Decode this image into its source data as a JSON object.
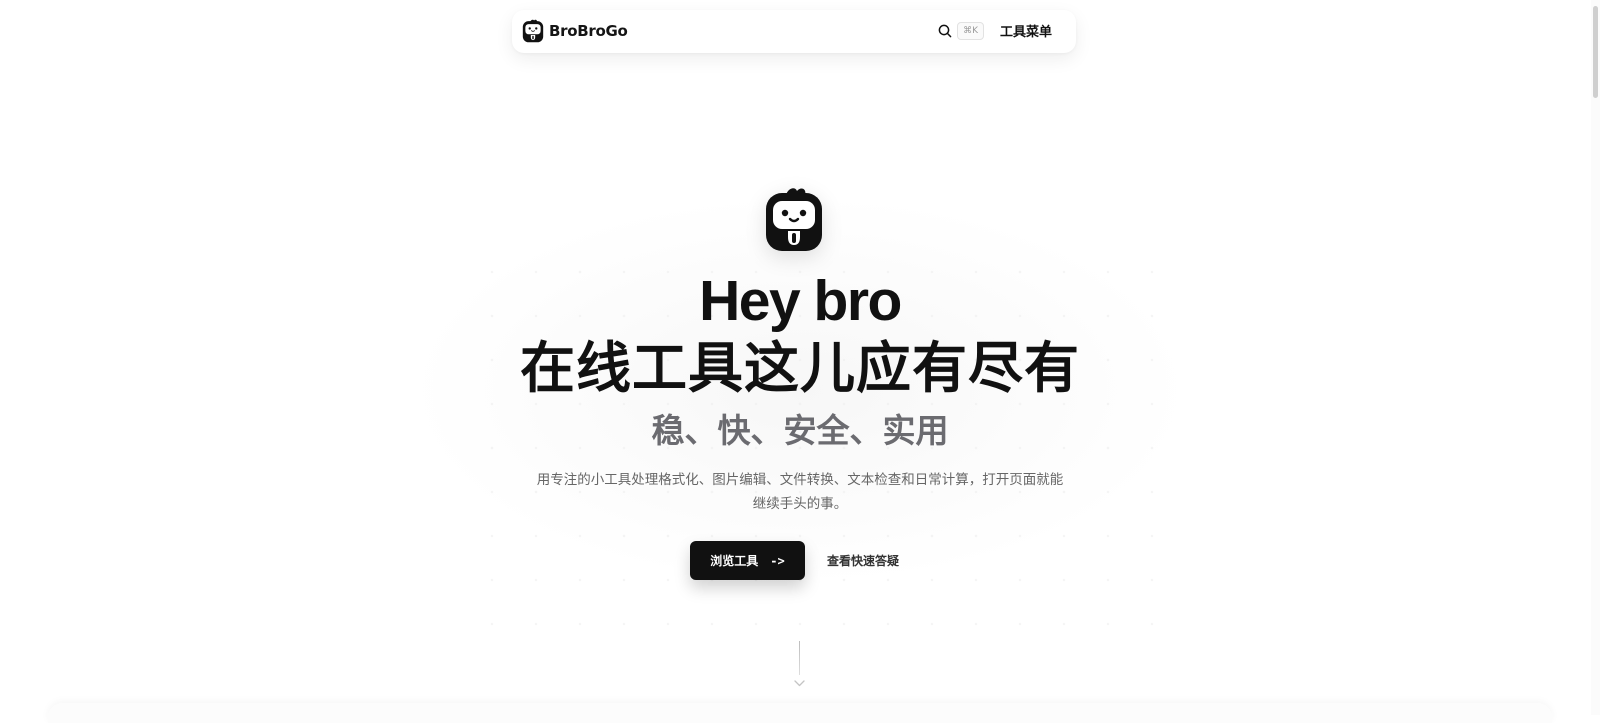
{
  "header": {
    "brand": "BroBroGo",
    "logo_icon": "mascot-logo-icon",
    "search_icon": "search-icon",
    "search_shortcut": "⌘K",
    "menu_label": "工具菜单"
  },
  "hero": {
    "logo_icon": "mascot-logo-icon",
    "title_en": "Hey bro",
    "title_zh": "在线工具这儿应有尽有",
    "tagline": "稳、快、安全、实用",
    "description": "用专注的小工具处理格式化、图片编辑、文件转换、文本检查和日常计算，打开页面就能继续手头的事。",
    "primary_button": "浏览工具",
    "primary_button_arrow": "->",
    "secondary_link": "查看快速答疑",
    "scroll_icon": "chevron-down-icon"
  },
  "colors": {
    "text": "#111111",
    "tagline": "#6b6b70",
    "description": "#666666",
    "primary_button_bg": "#111111",
    "primary_button_text": "#ffffff",
    "background": "#ffffff"
  }
}
